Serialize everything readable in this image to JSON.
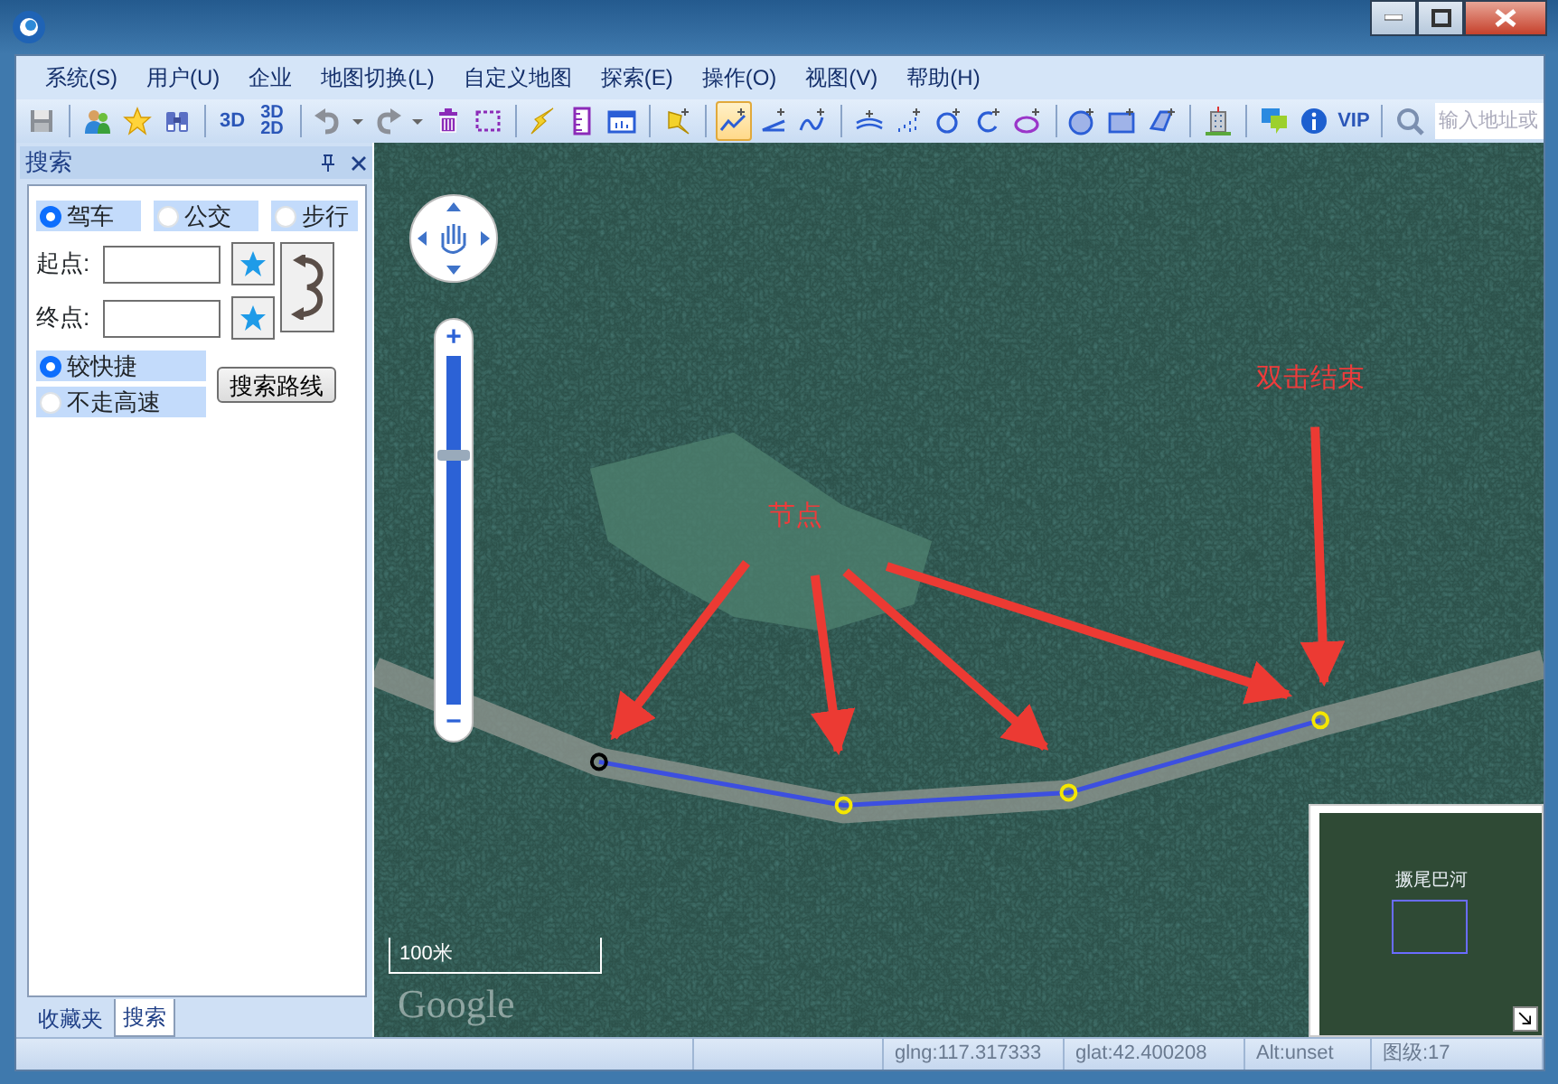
{
  "menu": [
    "系统(S)",
    "用户(U)",
    "企业",
    "地图切换(L)",
    "自定义地图",
    "探索(E)",
    "操作(O)",
    "视图(V)",
    "帮助(H)"
  ],
  "toolbar": [
    {
      "kind": "icon",
      "selected": false
    },
    {
      "kind": "separator"
    },
    {
      "kind": "icon",
      "selected": false
    },
    {
      "kind": "icon",
      "selected": false
    },
    {
      "kind": "icon",
      "selected": false
    },
    {
      "kind": "separator"
    },
    {
      "kind": "text",
      "label": "3D",
      "selected": false
    },
    {
      "kind": "stack",
      "top": "3D",
      "bottom": "2D",
      "selected": false
    },
    {
      "kind": "separator"
    },
    {
      "kind": "icon",
      "selected": false
    },
    {
      "kind": "icon",
      "selected": false
    },
    {
      "kind": "icon",
      "selected": false
    },
    {
      "kind": "icon",
      "selected": false
    },
    {
      "kind": "icon",
      "selected": false
    },
    {
      "kind": "icon",
      "selected": false
    },
    {
      "kind": "separator"
    },
    {
      "kind": "icon",
      "selected": false
    },
    {
      "kind": "icon",
      "selected": false
    },
    {
      "kind": "icon",
      "selected": false
    },
    {
      "kind": "separator"
    },
    {
      "kind": "icon",
      "selected": false
    },
    {
      "kind": "separator"
    },
    {
      "kind": "icon",
      "selected": true
    },
    {
      "kind": "icon",
      "selected": false
    },
    {
      "kind": "icon",
      "selected": false
    },
    {
      "kind": "separator"
    },
    {
      "kind": "icon",
      "selected": false
    },
    {
      "kind": "icon",
      "selected": false
    },
    {
      "kind": "icon",
      "selected": false
    },
    {
      "kind": "icon",
      "selected": false
    },
    {
      "kind": "icon",
      "selected": false
    },
    {
      "kind": "separator"
    },
    {
      "kind": "icon",
      "selected": false
    },
    {
      "kind": "icon",
      "selected": false
    },
    {
      "kind": "icon",
      "selected": false
    },
    {
      "kind": "separator"
    },
    {
      "kind": "icon",
      "selected": false
    },
    {
      "kind": "separator"
    },
    {
      "kind": "icon",
      "selected": false
    },
    {
      "kind": "icon",
      "selected": false
    },
    {
      "kind": "text",
      "label": "VIP",
      "selected": false
    },
    {
      "kind": "separator"
    },
    {
      "kind": "icon",
      "selected": false
    }
  ],
  "address_search": {
    "placeholder": "输入地址或"
  },
  "side_panel": {
    "title": "搜索",
    "travel_modes": [
      {
        "label": "驾车",
        "selected": true
      },
      {
        "label": "公交",
        "selected": false
      },
      {
        "label": "步行",
        "selected": false
      }
    ],
    "start": {
      "label": "起点:"
    },
    "end": {
      "label": "终点:"
    },
    "route_options": [
      {
        "label": "较快捷",
        "selected": true
      },
      {
        "label": "不走高速",
        "selected": false
      }
    ],
    "search_button": "搜索路线",
    "tabs": [
      {
        "label": "收藏夹",
        "selected": false
      },
      {
        "label": "搜索",
        "selected": true
      }
    ]
  },
  "map": {
    "zoom": {
      "in_label": "+",
      "out_label": "−",
      "level": 0.71
    },
    "annotations": [
      {
        "text": "节点"
      },
      {
        "text": "双击结束"
      }
    ],
    "scale": "100米",
    "logo": "Google",
    "overview": {
      "label": "撅尾巴河"
    }
  },
  "status_bar": [
    "glng:117.317333",
    "glat:42.400208",
    "Alt:unset",
    "图级:17"
  ]
}
